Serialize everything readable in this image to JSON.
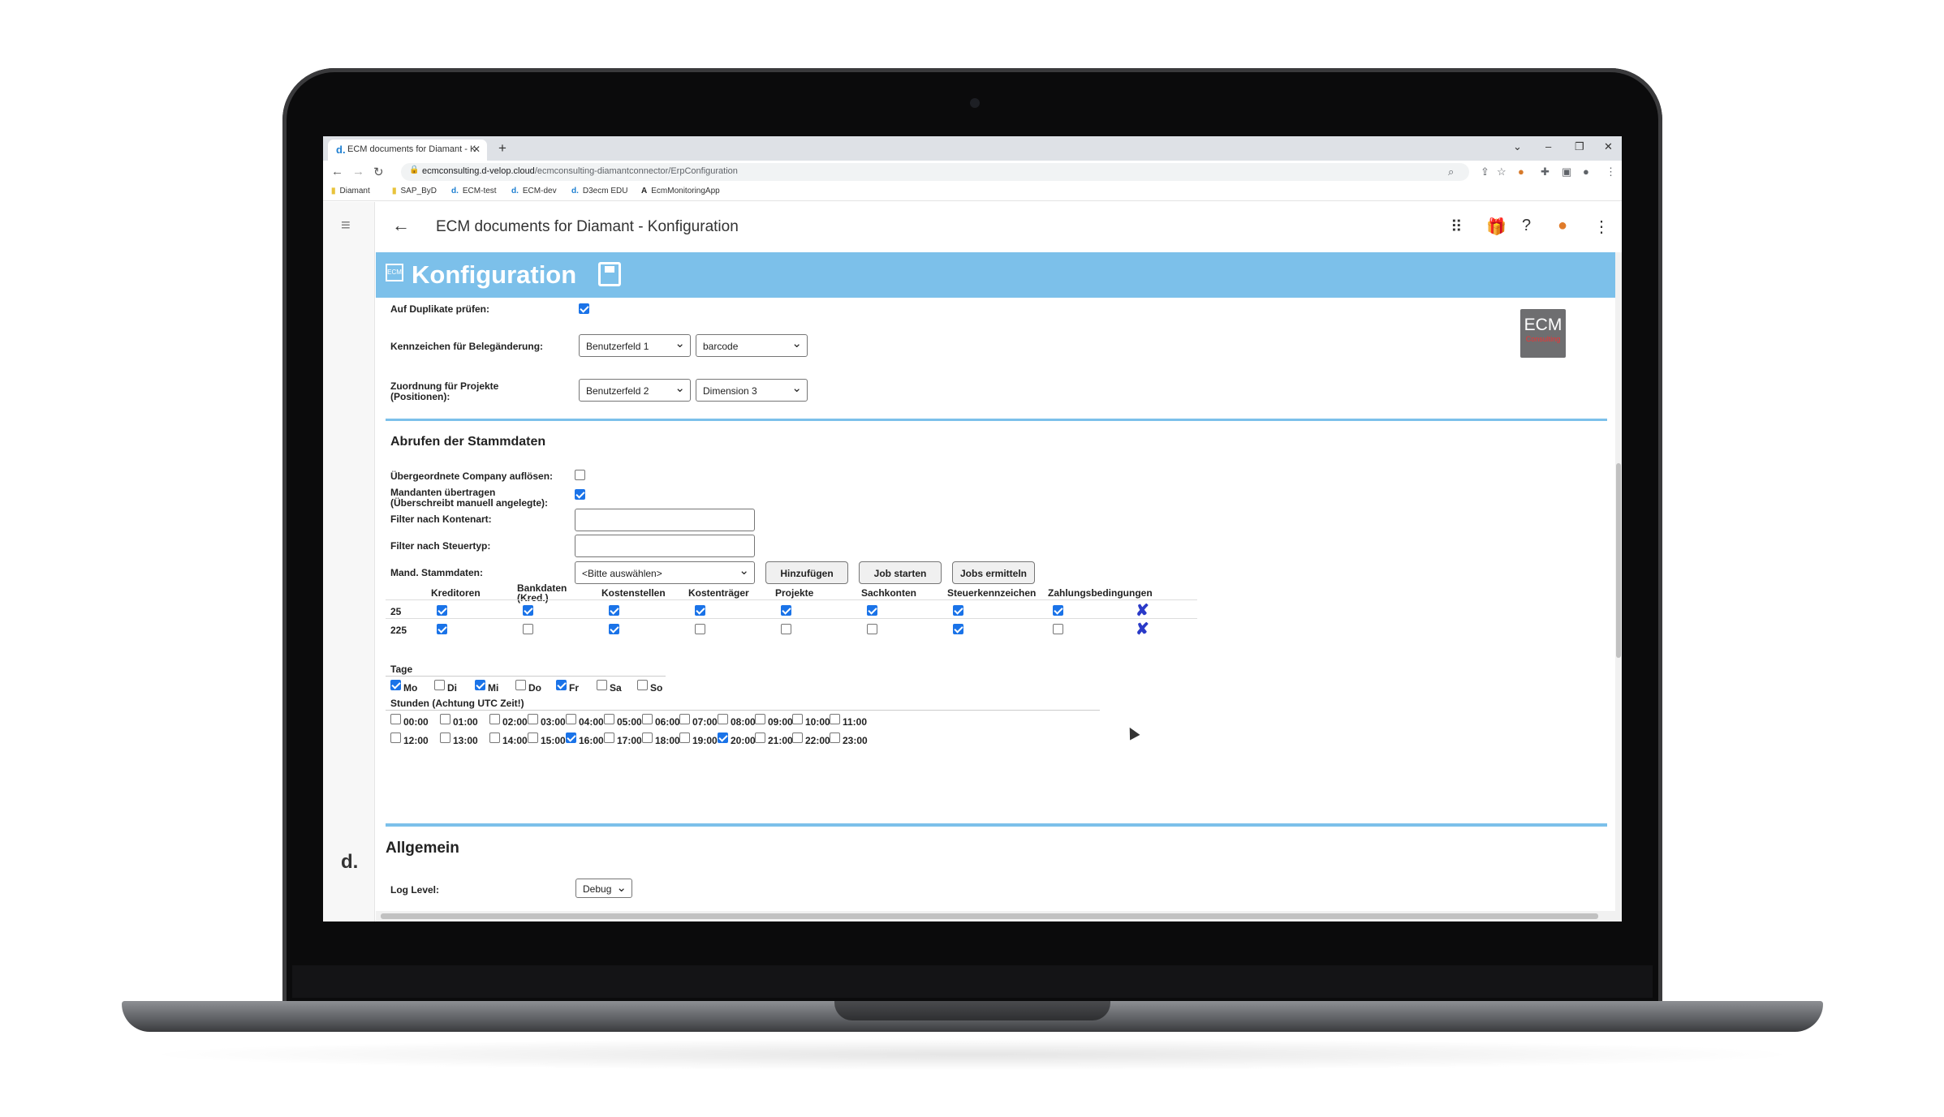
{
  "browser": {
    "tab_title": "ECM documents for Diamant - K",
    "url_host": "ecmconsulting.d-velop.cloud",
    "url_path": "/ecmconsulting-diamantconnector/ErpConfiguration",
    "bookmarks": [
      "Diamant",
      "SAP_ByD",
      "ECM-test",
      "ECM-dev",
      "D3ecm EDU",
      "EcmMonitoringApp"
    ]
  },
  "app": {
    "title": "ECM documents for Diamant - Konfiguration",
    "banner_title": "Konfiguration",
    "rail_logo": "d.",
    "logo": {
      "text": "ECM",
      "sub": "Consulting"
    }
  },
  "settings": {
    "duplicates_label": "Auf Duplikate prüfen:",
    "duplicates_checked": true,
    "change_flag_label": "Kennzeichen für Belegänderung:",
    "change_flag_values": [
      "Benutzerfeld 1",
      "barcode"
    ],
    "project_map_label_1": "Zuordnung für Projekte",
    "project_map_label_2": "(Positionen):",
    "project_map_values": [
      "Benutzerfeld 2",
      "Dimension 3"
    ]
  },
  "masterdata": {
    "heading": "Abrufen der Stammdaten",
    "parent_company_label": "Übergeordnete Company auflösen:",
    "parent_company_checked": false,
    "mandants_label_1": "Mandanten übertragen",
    "mandants_label_2": "(Überschreibt manuell angelegte):",
    "mandants_checked": true,
    "filter_account_label": "Filter nach Kontenart:",
    "filter_account_value": "",
    "filter_tax_label": "Filter nach Steuertyp:",
    "filter_tax_value": "",
    "mand_label": "Mand. Stammdaten:",
    "mand_select": "<Bitte auswählen>",
    "btn_add": "Hinzufügen",
    "btn_start": "Job starten",
    "btn_jobs": "Jobs ermitteln",
    "columns": [
      "Kreditoren",
      "Bankdaten",
      "(Kred.)",
      "Kostenstellen",
      "Kostenträger",
      "Projekte",
      "Sachkonten",
      "Steuerkennzeichen",
      "Zahlungsbedingungen"
    ],
    "rows": [
      {
        "id": "25",
        "checks": [
          true,
          true,
          true,
          true,
          true,
          true,
          true,
          true
        ]
      },
      {
        "id": "225",
        "checks": [
          true,
          false,
          true,
          false,
          false,
          false,
          true,
          false
        ]
      }
    ],
    "days_label": "Tage",
    "days": [
      {
        "label": "Mo",
        "checked": true
      },
      {
        "label": "Di",
        "checked": false
      },
      {
        "label": "Mi",
        "checked": true
      },
      {
        "label": "Do",
        "checked": false
      },
      {
        "label": "Fr",
        "checked": true
      },
      {
        "label": "Sa",
        "checked": false
      },
      {
        "label": "So",
        "checked": false
      }
    ],
    "hours_label": "Stunden (Achtung UTC Zeit!)",
    "hours": [
      "00:00",
      "01:00",
      "02:00",
      "03:00",
      "04:00",
      "05:00",
      "06:00",
      "07:00",
      "08:00",
      "09:00",
      "10:00",
      "11:00",
      "12:00",
      "13:00",
      "14:00",
      "15:00",
      "16:00",
      "17:00",
      "18:00",
      "19:00",
      "20:00",
      "21:00",
      "22:00",
      "23:00"
    ],
    "hours_checked": [
      "16:00",
      "20:00"
    ]
  },
  "general": {
    "heading": "Allgemein",
    "log_label": "Log Level:",
    "log_value": "Debug"
  },
  "colors": {
    "banner": "#7cc0ea",
    "accent": "#1a73e8",
    "delete": "#2a3ac8"
  }
}
